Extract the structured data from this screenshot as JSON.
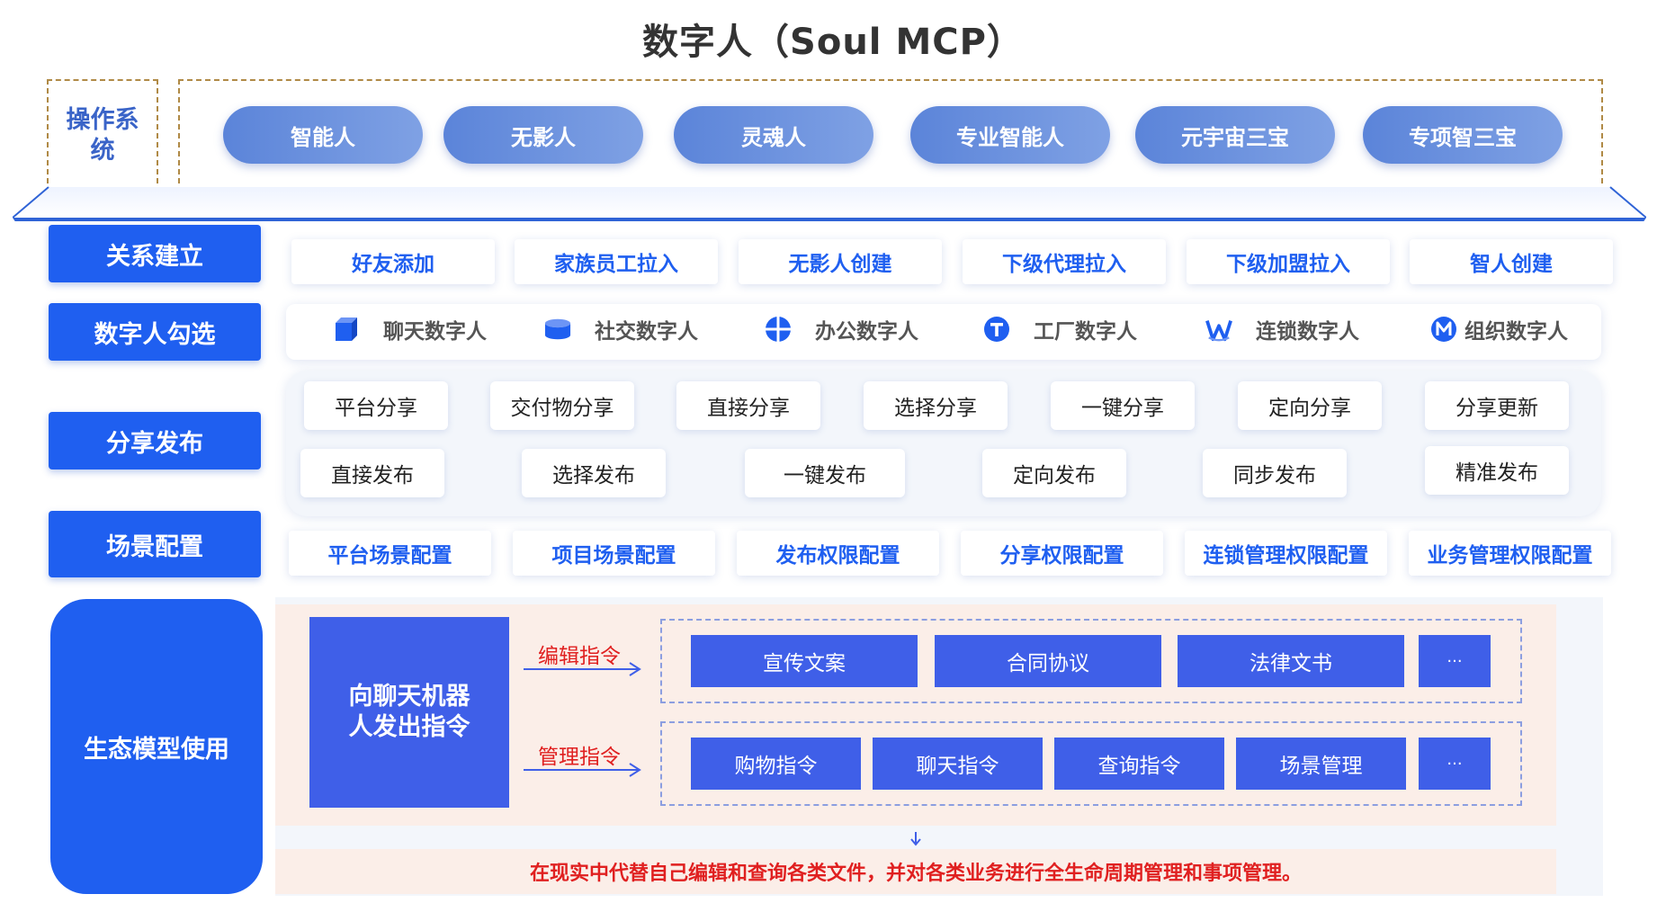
{
  "title": "数字人（Soul MCP）",
  "os": {
    "label": "操作系统",
    "pills": [
      "智能人",
      "无影人",
      "灵魂人",
      "专业智能人",
      "元宇宙三宝",
      "专项智三宝"
    ]
  },
  "relation": {
    "label": "关系建立",
    "items": [
      "好友添加",
      "家族员工拉入",
      "无影人创建",
      "下级代理拉入",
      "下级加盟拉入",
      "智人创建"
    ]
  },
  "select": {
    "label": "数字人勾选",
    "items": [
      {
        "icon": "cube-icon",
        "text": "聊天数字人"
      },
      {
        "icon": "database-icon",
        "text": "社交数字人"
      },
      {
        "icon": "crosshair-icon",
        "text": "办公数字人"
      },
      {
        "icon": "t-circle-icon",
        "text": "工厂数字人"
      },
      {
        "icon": "w-logo-icon",
        "text": "连锁数字人"
      },
      {
        "icon": "m-circle-icon",
        "text": "组织数字人"
      }
    ]
  },
  "share": {
    "label": "分享发布",
    "row1": [
      "平台分享",
      "交付物分享",
      "直接分享",
      "选择分享",
      "一键分享",
      "定向分享",
      "分享更新"
    ],
    "row2": [
      "直接发布",
      "选择发布",
      "一键发布",
      "定向发布",
      "同步发布",
      "精准发布"
    ]
  },
  "scene": {
    "label": "场景配置",
    "items": [
      "平台场景配置",
      "项目场景配置",
      "发布权限配置",
      "分享权限配置",
      "连锁管理权限配置",
      "业务管理权限配置"
    ]
  },
  "eco": {
    "label": "生态模型使用",
    "robot": "向聊天机器人发出指令",
    "edit_label": "编辑指令",
    "manage_label": "管理指令",
    "edit_items": [
      "宣传文案",
      "合同协议",
      "法律文书",
      "···"
    ],
    "manage_items": [
      "购物指令",
      "聊天指令",
      "查询指令",
      "场景管理",
      "···"
    ],
    "summary": "在现实中代替自己编辑和查询各类文件，并对各类业务进行全生命周期管理和事项管理。"
  },
  "colors": {
    "primary": "#1f5ff0",
    "chip_blue": "#3f5fe8",
    "pill": "#6b91dd",
    "accent_red": "#e02020"
  }
}
